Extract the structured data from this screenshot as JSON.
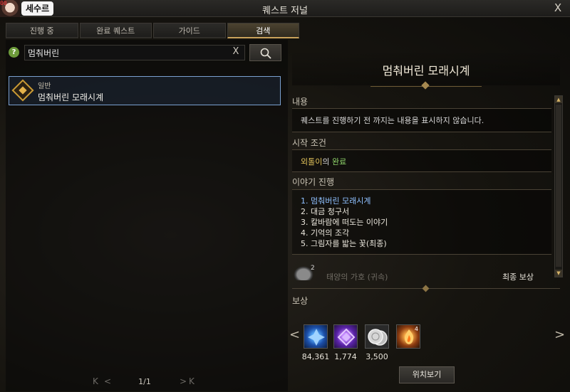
{
  "titlebar": {
    "title": "퀘스트 저널",
    "char_name": "세수르",
    "avatar_tag": "00",
    "close_label": "X"
  },
  "tabs": [
    {
      "label": "진행 중"
    },
    {
      "label": "완료 퀘스트"
    },
    {
      "label": "가이드"
    },
    {
      "label": "검색"
    }
  ],
  "search": {
    "value": "멈춰버린",
    "help_label": "?",
    "clear_label": "X"
  },
  "results": [
    {
      "type": "일반",
      "title": "멈춰버린 모래시계"
    }
  ],
  "pager": {
    "page": "1/1",
    "first": "K",
    "prev": "<",
    "next": ">",
    "last": "K"
  },
  "detail": {
    "title": "멈춰버린 모래시계",
    "content_label": "내용",
    "content_text": "퀘스트를 진행하기 전 까지는 내용을 표시하지 않습니다.",
    "start_label": "시작 조건",
    "start_link": "외톨이",
    "start_status": "완료",
    "progress_label": "이야기 진행",
    "progress": [
      "1. 멈춰버린 모래시계",
      "2. 대금 청구서",
      "3. 칼바람에 떠도는 이야기",
      "4. 기억의 조각",
      "5. 그림자를 밟는 꽃(최종)"
    ],
    "final_reward_item": "태양의 가호 (귀속)",
    "final_reward_count": "2",
    "final_reward_label": "최종 보상",
    "reward_label": "보상",
    "rewards": [
      {
        "qty": "84,361",
        "icon": "blue-star-icon",
        "color": "#2f6fd6"
      },
      {
        "qty": "1,774",
        "icon": "purple-gem-icon",
        "color": "#7a3cc9"
      },
      {
        "qty": "3,500",
        "icon": "silver-coin-icon",
        "color": "#9a9a9a"
      },
      {
        "qty": "",
        "icon": "fire-orb-icon",
        "color": "#c76a1a",
        "badge": "4"
      }
    ],
    "location_button": "위치보기",
    "prev_arrow": "<",
    "next_arrow": ">"
  }
}
